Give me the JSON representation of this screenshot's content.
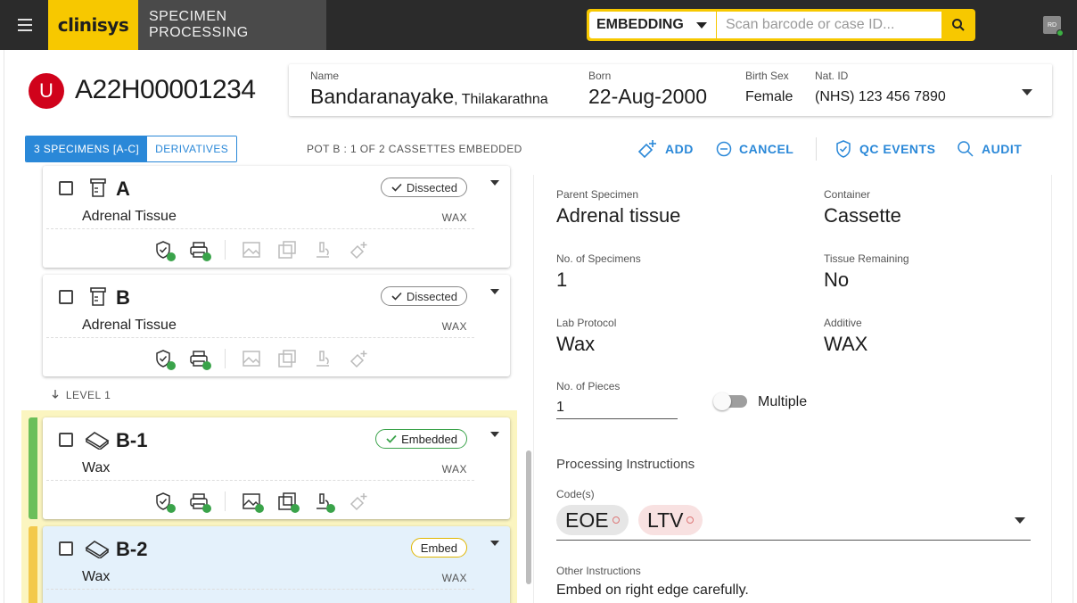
{
  "app": {
    "brand": "clinisys",
    "title": "SPECIMEN PROCESSING",
    "menu_icon": "hamburger-icon"
  },
  "search": {
    "mode": "EMBEDDING",
    "placeholder": "Scan barcode or case ID...",
    "value": ""
  },
  "user": {
    "initials": "RD",
    "status": "online"
  },
  "case": {
    "priority_letter": "U",
    "id": "A22H00001234",
    "badge_color": "#d0021b"
  },
  "patient": {
    "name_label": "Name",
    "surname": "Bandaranayake",
    "given": ", Thilakarathna",
    "born_label": "Born",
    "born": "22-Aug-2000",
    "sex_label": "Birth Sex",
    "sex": "Female",
    "natid_label": "Nat. ID",
    "natid": "(NHS) 123 456 7890"
  },
  "toolbar": {
    "tab_specimens": "3 SPECIMENS [A-C]",
    "tab_derivatives": "DERIVATIVES",
    "pot_status": "POT B : 1 OF 2 CASSETTES EMBEDDED",
    "add": "ADD",
    "cancel": "CANCEL",
    "qc_events": "QC EVENTS",
    "audit": "AUDIT",
    "accent": "#2a88d8"
  },
  "specimens": [
    {
      "label": "A",
      "tissue": "Adrenal Tissue",
      "medium": "WAX",
      "status": "Dissected",
      "type_icon": "pot-icon"
    },
    {
      "label": "B",
      "tissue": "Adrenal Tissue",
      "medium": "WAX",
      "status": "Dissected",
      "type_icon": "pot-icon"
    }
  ],
  "level_label": "LEVEL 1",
  "cassettes": [
    {
      "label": "B-1",
      "material": "Wax",
      "medium": "WAX",
      "status": "Embedded",
      "type_icon": "cassette-icon",
      "status_color": "#3aa34a"
    },
    {
      "label": "B-2",
      "material": "Wax",
      "medium": "WAX",
      "status": "Embed",
      "type_icon": "cassette-icon",
      "status_color": "#e0b600"
    }
  ],
  "detail": {
    "parent_label": "Parent Specimen",
    "parent": "Adrenal tissue",
    "container_label": "Container",
    "container": "Cassette",
    "nspec_label": "No. of Specimens",
    "nspec": "1",
    "remaining_label": "Tissue Remaining",
    "remaining": "No",
    "protocol_label": "Lab Protocol",
    "protocol": "Wax",
    "additive_label": "Additive",
    "additive": "WAX",
    "pieces_label": "No. of Pieces",
    "pieces": "1",
    "multiple_label": "Multiple",
    "multiple_on": false,
    "proc_title": "Processing Instructions",
    "codes_label": "Code(s)",
    "codes": [
      "EOE",
      "LTV"
    ],
    "other_label": "Other Instructions",
    "other": "Embed on right edge carefully."
  }
}
